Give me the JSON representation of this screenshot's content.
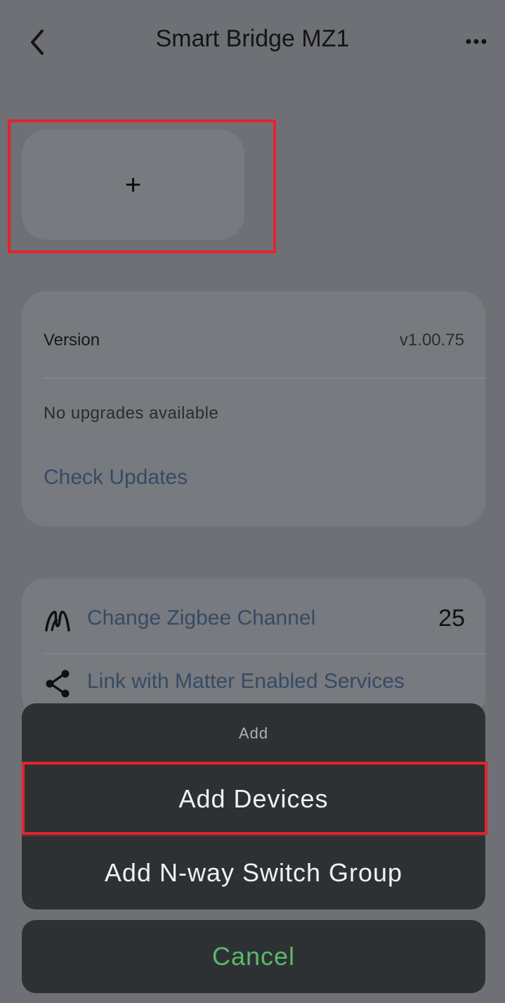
{
  "header": {
    "title": "Smart Bridge MZ1",
    "back_icon": "chevron-left-icon",
    "more_icon": "more-horizontal-icon"
  },
  "add_tile": {
    "symbol": "+",
    "highlighted": true
  },
  "version_card": {
    "label": "Version",
    "value": "v1.00.75",
    "status": "No upgrades available",
    "check_updates": "Check Updates"
  },
  "settings": {
    "zigbee": {
      "icon": "zigbee-icon",
      "label": "Change Zigbee Channel",
      "value": "25"
    },
    "matter": {
      "icon": "share-icon",
      "label": "Link with Matter Enabled Services"
    }
  },
  "action_sheet": {
    "title": "Add",
    "options": [
      "Add Devices",
      "Add N-way Switch Group"
    ],
    "highlighted_option": "Add Devices",
    "cancel": "Cancel"
  },
  "colors": {
    "highlight": "#e3242b",
    "link": "#364a66",
    "cancel": "#5cb86a",
    "sheet_bg": "#2e3134",
    "overlay_bg": "#6e7075"
  }
}
